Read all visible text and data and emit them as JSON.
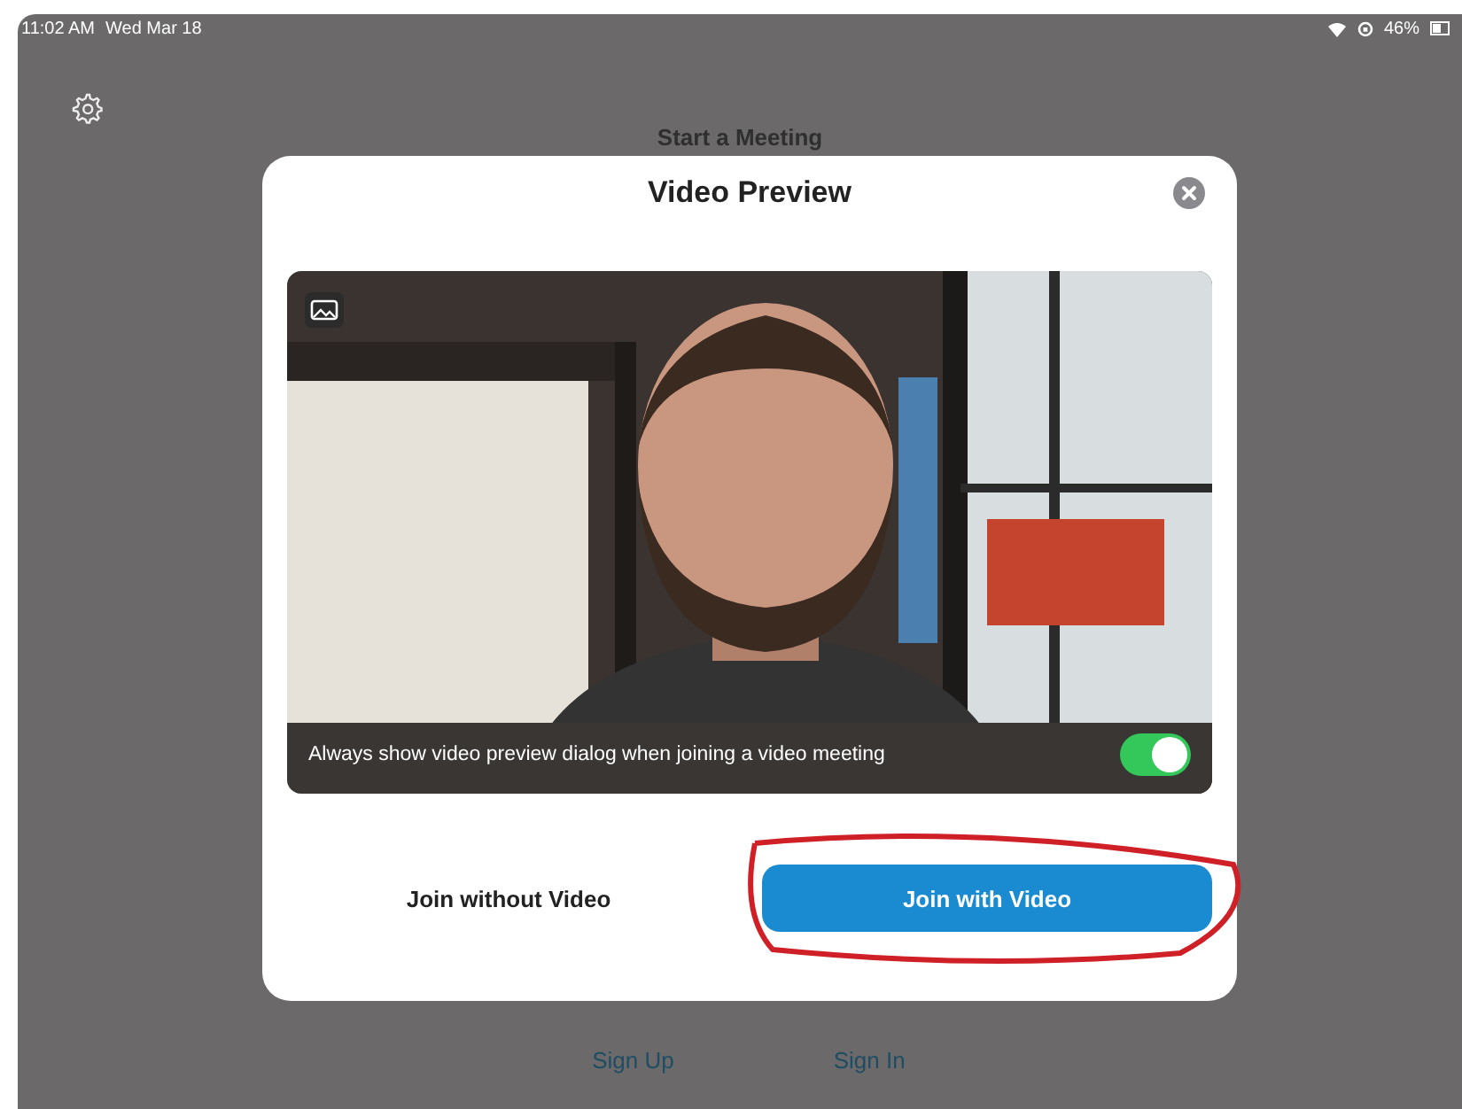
{
  "status_bar": {
    "time": "11:02 AM",
    "date": "Wed Mar 18",
    "battery": "46%"
  },
  "background_screen": {
    "title": "Start a Meeting",
    "links": [
      {
        "label": "Sign Up"
      },
      {
        "label": "Sign In"
      }
    ]
  },
  "dialog": {
    "title": "Video Preview",
    "option": {
      "label": "Always show video preview dialog when joining a video meeting",
      "on": true
    },
    "buttons": [
      {
        "label": "Join without Video",
        "kind": "secondary"
      },
      {
        "label": "Join with Video",
        "kind": "primary"
      }
    ]
  }
}
